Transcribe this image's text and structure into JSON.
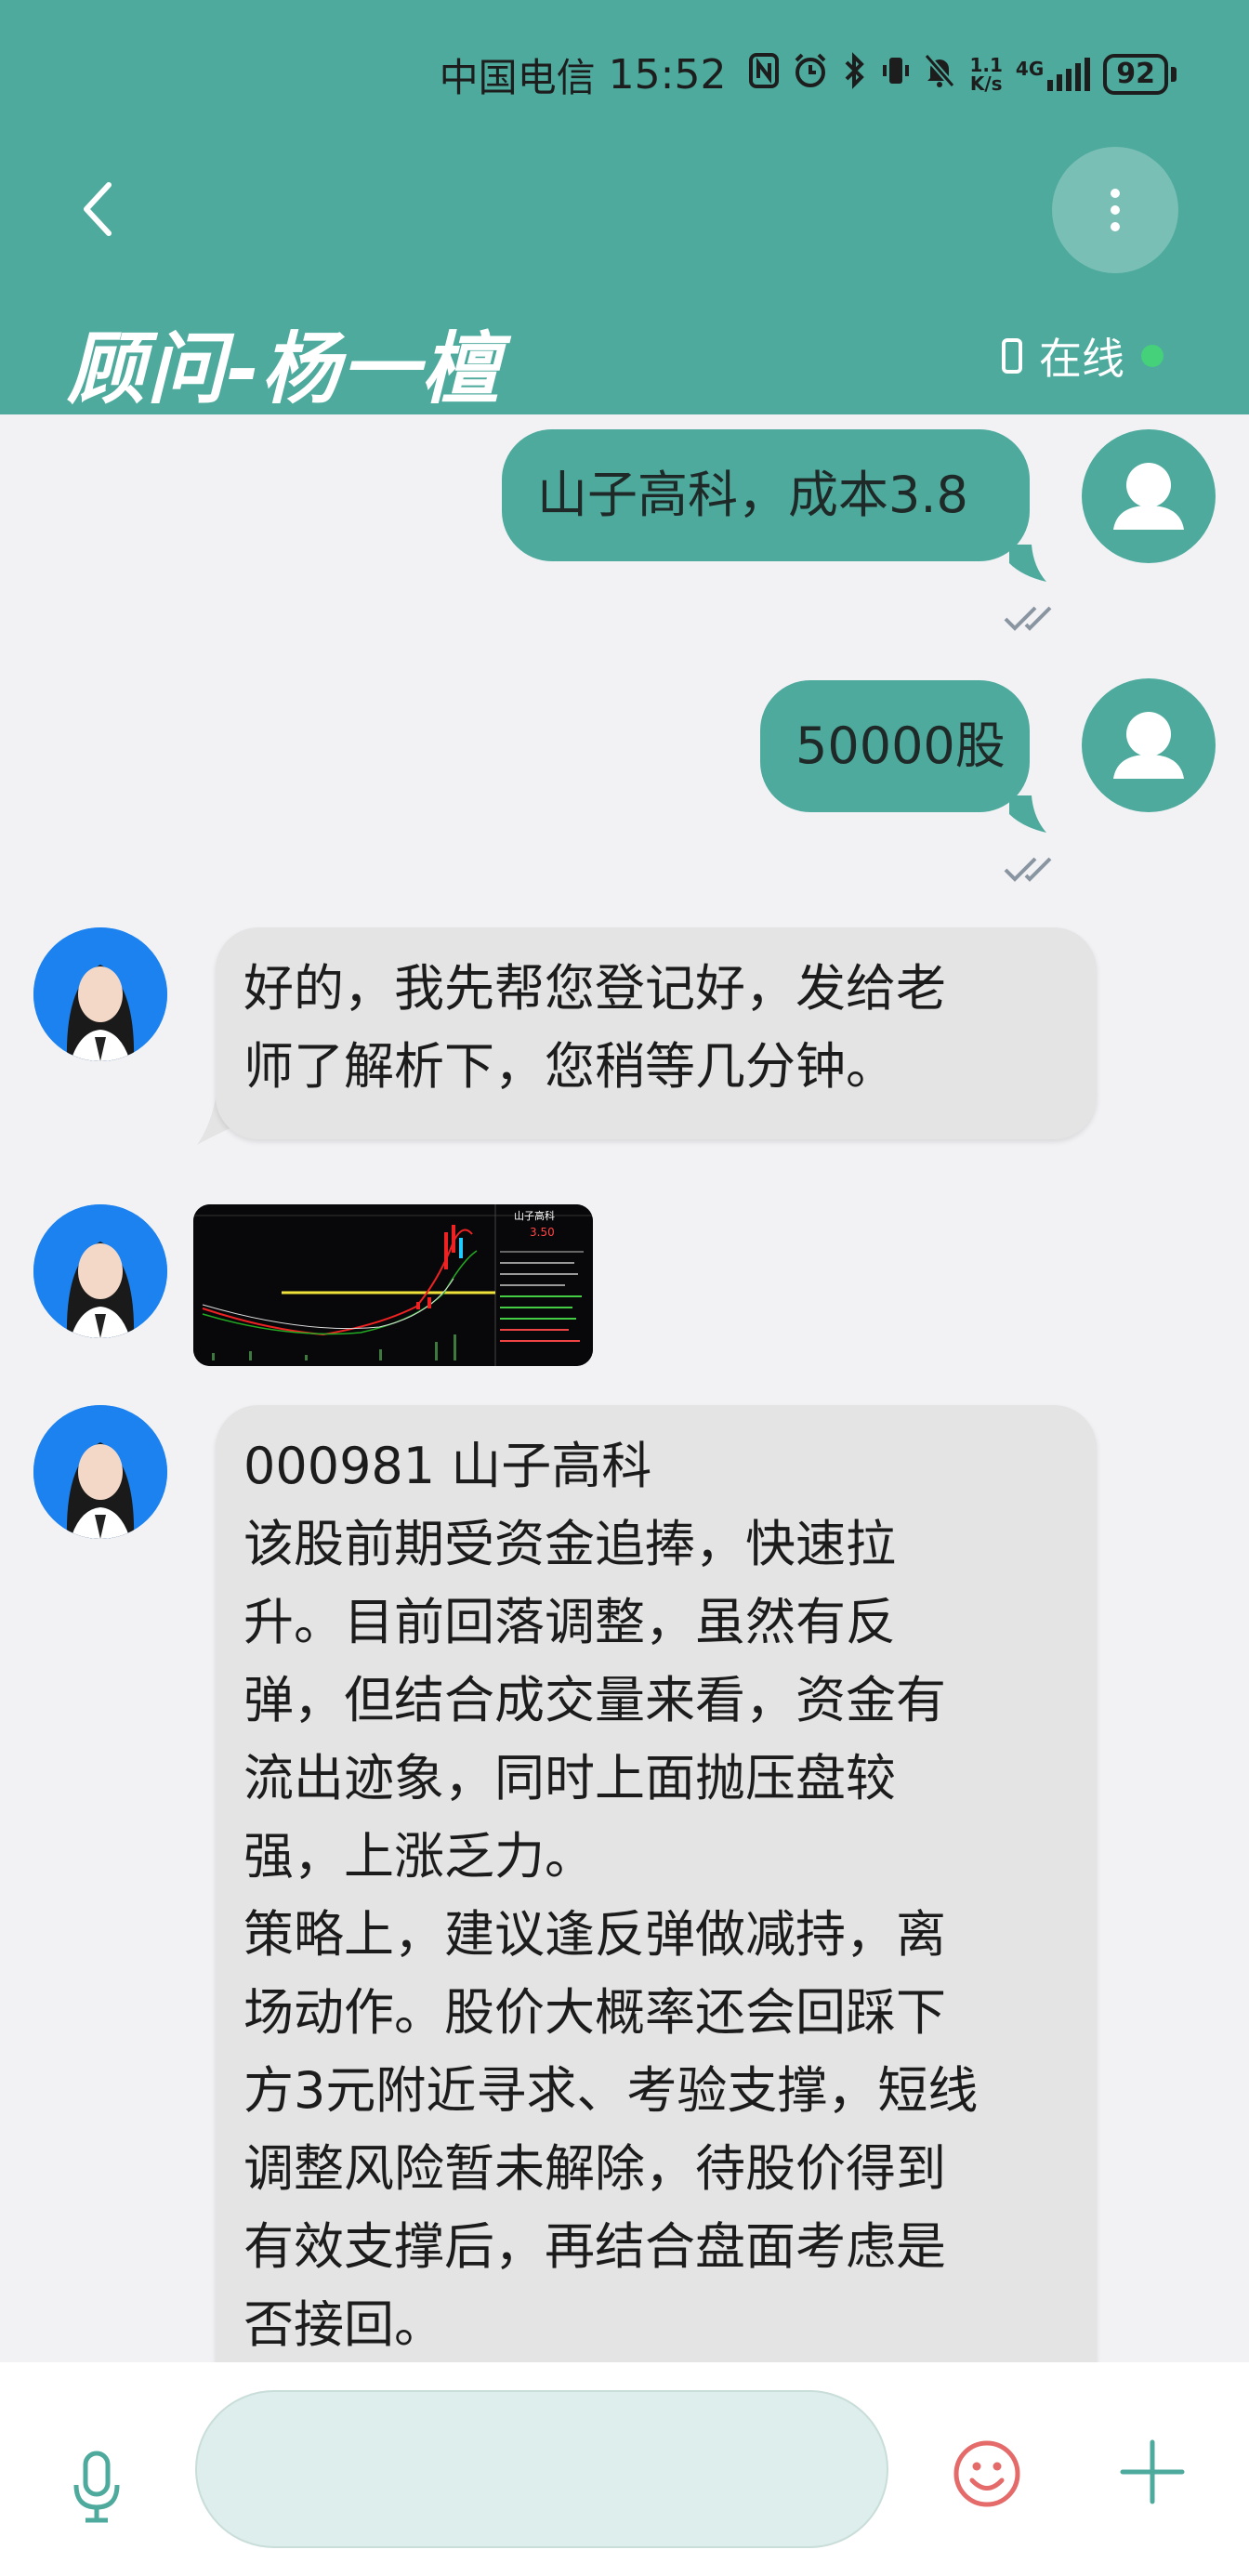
{
  "status_bar": {
    "carrier": "中国电信",
    "time": "15:52",
    "net_speed_value": "1.1",
    "net_speed_unit": "K/s",
    "network": "4G",
    "battery": "92"
  },
  "header": {
    "title": "顾问-杨一檀",
    "status": "在线"
  },
  "messages": {
    "out1": {
      "text": "山子高科，成本3.8"
    },
    "out2": {
      "text": "50000股"
    },
    "in1": {
      "lines": [
        "好的，我先帮您登记好，发给老",
        "师了解析下，您稍等几分钟。"
      ]
    },
    "in2": {
      "image_alt": "山子高科 K线图"
    },
    "in3": {
      "lines": [
        "000981 山子高科",
        "该股前期受资金追捧，快速拉",
        "升。目前回落调整，虽然有反",
        "弹，但结合成交量来看，资金有",
        "流出迹象，同时上面抛压盘较",
        "强，上涨乏力。",
        "策略上，建议逢反弹做减持，离",
        "场动作。股价大概率还会回踩下",
        "方3元附近寻求、考验支撑，短线",
        "调整风险暂未解除，待股价得到",
        "有效支撑后，再结合盘面考虑是",
        "否接回。"
      ]
    }
  },
  "chart_thumb": {
    "name": "山子高科",
    "price": "3.50"
  },
  "composer": {
    "placeholder": ""
  },
  "colors": {
    "accent": "#4daa9d",
    "incoming_bubble": "#e4e4e4",
    "emoji": "#e56a6a"
  }
}
